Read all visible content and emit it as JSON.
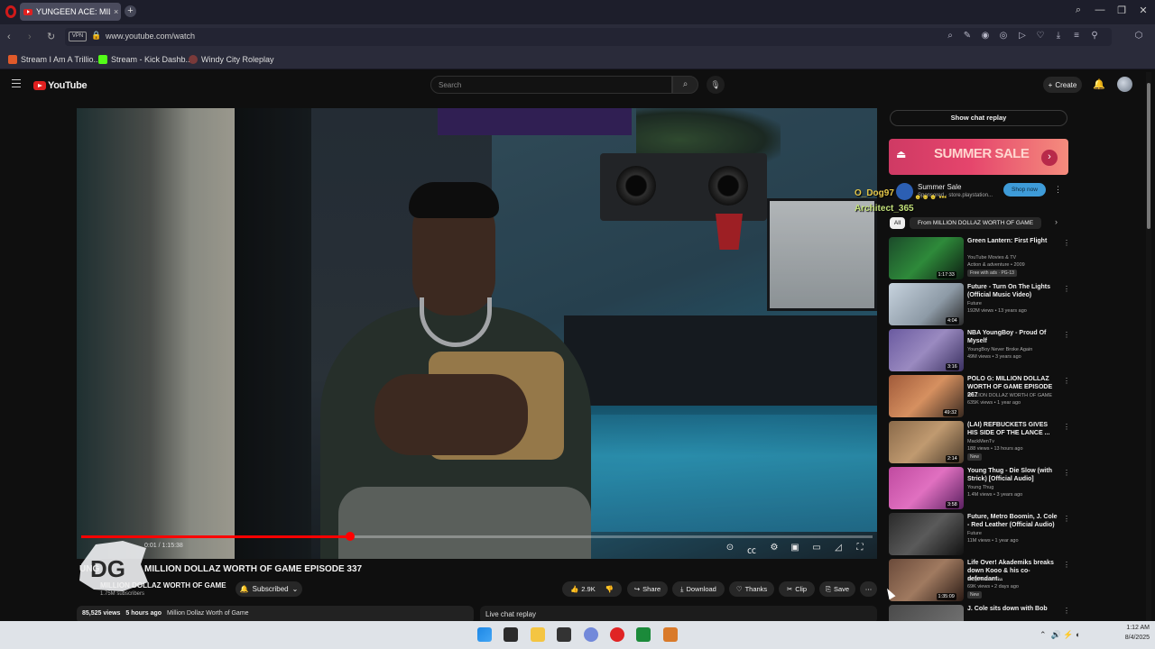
{
  "browser": {
    "tab_title": "YUNGEEN ACE: MILLION",
    "tab_close": "×",
    "new_tab": "+",
    "url": "www.youtube.com/watch",
    "vpn_label": "VPN",
    "bookmarks": [
      {
        "label": "Stream I Am A Trillio...",
        "color": "#e05a2a"
      },
      {
        "label": "Stream - Kick Dashb...",
        "color": "#53fc18"
      },
      {
        "label": "Windy City Roleplay",
        "color": "#7a3a3a"
      }
    ]
  },
  "youtube": {
    "logo_text": "YouTube",
    "search_placeholder": "Search",
    "create_label": "Create"
  },
  "video": {
    "time": "0:01 / 1:15:38",
    "progress_fraction": 0.34,
    "title": "MILLION DOLLAZ WORTH OF GAME EPISODE 337",
    "title_prefix": "UNG",
    "channel": "MILLION DOLLAZ WORTH OF GAME",
    "subscribers": "1.75M subscribers",
    "subscribed_label": "Subscribed",
    "likes": "2.9K",
    "share": "Share",
    "download": "Download",
    "thanks": "Thanks",
    "clip": "Clip",
    "save": "Save",
    "views": "85,525 views",
    "ago": "5 hours ago",
    "desc_channel": "Million Dollaz Worth of Game",
    "live_chat_replay": "Live chat replay"
  },
  "sidebar": {
    "show_chat_replay": "Show chat replay",
    "ad": {
      "banner_text": "SUMMER SALE",
      "title": "Summer Sale",
      "sponsor": "Sponsored · store.playstation...",
      "cta": "Shop now"
    },
    "chat_overlay": {
      "user1": "O_Dog97",
      "user2": "Architect_365"
    },
    "chips": {
      "all": "All",
      "from": "From MILLION DOLLAZ WORTH OF GAME"
    },
    "recommendations": [
      {
        "title": "Green Lantern: First Flight",
        "channel": "YouTube Movies & TV",
        "meta": "Action & adventure • 2009",
        "badge": "Free with ads · PG-13",
        "duration": "1:17:33",
        "bg": "linear-gradient(135deg,#1b4a2a,#2e8a3a 50%,#0d1e12)"
      },
      {
        "title": "Future - Turn On The Lights (Official Music Video)",
        "channel": "Future",
        "meta": "192M views • 13 years ago",
        "badge": "",
        "duration": "4:04",
        "bg": "linear-gradient(135deg,#c7d3de,#8d9aa6 60%,#2a2a2a)"
      },
      {
        "title": "NBA YoungBoy - Proud Of Myself",
        "channel": "YoungBoy Never Broke Again",
        "meta": "49M views • 3 years ago",
        "badge": "",
        "duration": "3:16",
        "bg": "linear-gradient(135deg,#6a5aa0,#9a8ac0 50%,#3a3060)"
      },
      {
        "title": "POLO G: MILLION DOLLAZ WORTH OF GAME EPISODE 267",
        "channel": "MILLION DOLLAZ WORTH OF GAME",
        "meta": "635K views • 1 year ago",
        "badge": "",
        "duration": "49:32",
        "bg": "linear-gradient(135deg,#a05a3a,#d69060 50%,#3a2a20)"
      },
      {
        "title": "(LAI) REFBUCKETS GIVES HIS SIDE OF THE LANCE ...",
        "channel": "MackMenTv",
        "meta": "188 views • 13 hours ago",
        "badge": "New",
        "duration": "2:14",
        "bg": "linear-gradient(135deg,#8a6a4a,#c09a70 50%,#4a3a2a)"
      },
      {
        "title": "Young Thug - Die Slow (with Strick) [Official Audio]",
        "channel": "Young Thug",
        "meta": "1.4M views • 3 years ago",
        "badge": "",
        "duration": "3:58",
        "bg": "linear-gradient(135deg,#c04aa0,#e070c0 50%,#5a2060)"
      },
      {
        "title": "Future, Metro Boomin, J. Cole - Red Leather (Official Audio)",
        "channel": "Future",
        "meta": "11M views • 1 year ago",
        "badge": "",
        "duration": "",
        "bg": "linear-gradient(135deg,#2a2a2a,#5a5a5a 50%,#111)"
      },
      {
        "title": "Life Over! Akademiks breaks down Kooo & his co-defendant...",
        "channel": "King Akademiks",
        "meta": "69K views • 2 days ago",
        "badge": "New",
        "duration": "1:35:09",
        "bg": "linear-gradient(135deg,#6a4a3a,#a07a60 50%,#2a1a14)"
      },
      {
        "title": "J. Cole sits down with Bob",
        "channel": "",
        "meta": "",
        "badge": "",
        "duration": "",
        "bg": "linear-gradient(135deg,#4a4a4a,#7a7a7a)"
      }
    ]
  },
  "taskbar": {
    "time": "1:12 AM",
    "date": "8/4/2025"
  },
  "colors": {
    "yt_red": "#ff0000",
    "chat_user1": "#e6c84a",
    "chat_user2": "#c2e07a"
  }
}
